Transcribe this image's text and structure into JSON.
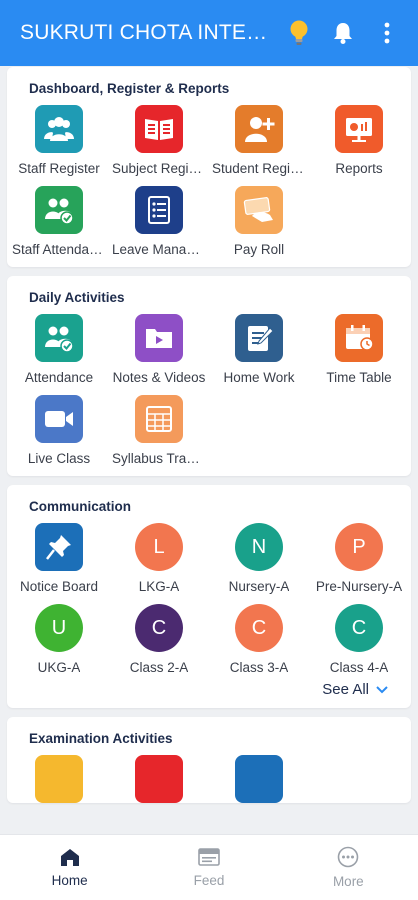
{
  "appbar": {
    "title": "SUKRUTI CHOTA INTERNATIONAL SCHOOL"
  },
  "sections": [
    {
      "title": "Dashboard, Register & Reports",
      "items": [
        {
          "label": "Staff Register",
          "icon": "staff-register-icon",
          "color": "#1f9bb4"
        },
        {
          "label": "Subject Register",
          "icon": "subject-register-icon",
          "color": "#e6262b"
        },
        {
          "label": "Student Register",
          "icon": "student-register-icon",
          "color": "#e47c2b"
        },
        {
          "label": "Reports",
          "icon": "reports-icon",
          "color": "#f05b2b"
        },
        {
          "label": "Staff Attendance",
          "icon": "staff-attendance-icon",
          "color": "#27a35a"
        },
        {
          "label": "Leave Management",
          "icon": "leave-management-icon",
          "color": "#1e3f8a"
        },
        {
          "label": "Pay Roll",
          "icon": "pay-roll-icon",
          "color": "#f6a85a"
        }
      ]
    },
    {
      "title": "Daily Activities",
      "items": [
        {
          "label": "Attendance",
          "icon": "attendance-icon",
          "color": "#1aa28f"
        },
        {
          "label": "Notes & Videos",
          "icon": "notes-videos-icon",
          "color": "#8e4fc6"
        },
        {
          "label": "Home Work",
          "icon": "home-work-icon",
          "color": "#2f5f8f"
        },
        {
          "label": "Time Table",
          "icon": "time-table-icon",
          "color": "#ec6b2a"
        },
        {
          "label": "Live Class",
          "icon": "live-class-icon",
          "color": "#4b78c8"
        },
        {
          "label": "Syllabus Tracker",
          "icon": "syllabus-tracker-icon",
          "color": "#f49a5b"
        }
      ]
    },
    {
      "title": "Communication",
      "items": [
        {
          "label": "Notice Board",
          "icon": "notice-board-icon",
          "color": "#1c6fb8",
          "round": false
        },
        {
          "label": "LKG-A",
          "letter": "L",
          "color": "#f2764f",
          "round": true
        },
        {
          "label": "Nursery-A",
          "letter": "N",
          "color": "#19a18b",
          "round": true
        },
        {
          "label": "Pre-Nursery-A",
          "letter": "P",
          "color": "#f2764f",
          "round": true
        },
        {
          "label": "UKG-A",
          "letter": "U",
          "color": "#3fb332",
          "round": true
        },
        {
          "label": "Class 2-A",
          "letter": "C",
          "color": "#4b2a70",
          "round": true
        },
        {
          "label": "Class 3-A",
          "letter": "C",
          "color": "#f2764f",
          "round": true
        },
        {
          "label": "Class 4-A",
          "letter": "C",
          "color": "#19a18b",
          "round": true
        }
      ],
      "see_all": "See All"
    },
    {
      "title": "Examination Activities"
    }
  ],
  "bottom_nav": [
    {
      "label": "Home",
      "icon": "home-icon",
      "active": true
    },
    {
      "label": "Feed",
      "icon": "feed-icon",
      "active": false
    },
    {
      "label": "More",
      "icon": "more-icon",
      "active": false
    }
  ]
}
